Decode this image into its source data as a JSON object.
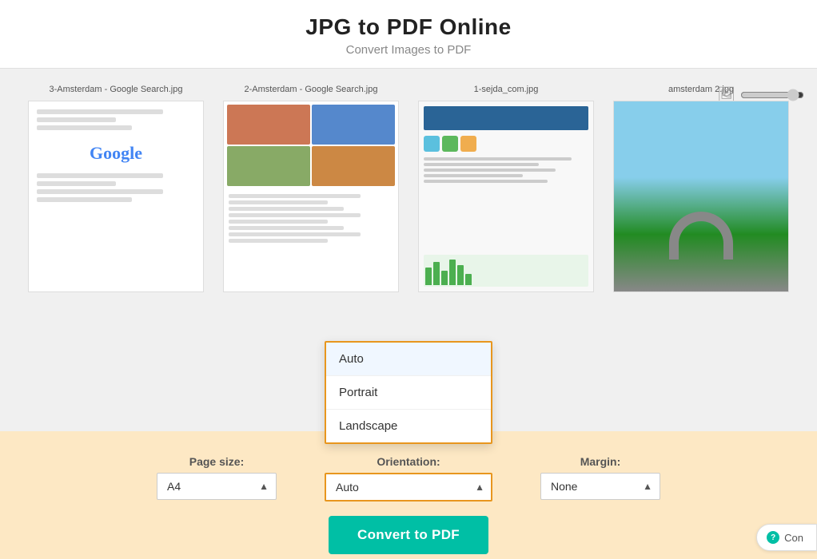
{
  "header": {
    "title": "JPG to PDF Online",
    "subtitle": "Convert Images to PDF"
  },
  "zoom": {
    "value": 90
  },
  "images": [
    {
      "id": "img1",
      "label": "3-Amsterdam - Google Search.jpg",
      "type": "google1"
    },
    {
      "id": "img2",
      "label": "2-Amsterdam - Google Search.jpg",
      "type": "amsterdam"
    },
    {
      "id": "img3",
      "label": "1-sejda_com.jpg",
      "type": "sejda"
    },
    {
      "id": "img4",
      "label": "amsterdam 2.jpg",
      "type": "photo"
    }
  ],
  "controls": {
    "page_size_label": "Page size:",
    "page_size_value": "A4",
    "margin_label": "Margin:",
    "margin_value": "None",
    "orientation_label": "Orientation:",
    "orientation_value": "Auto"
  },
  "dropdown": {
    "options": [
      {
        "label": "Auto",
        "selected": true
      },
      {
        "label": "Portrait",
        "selected": false
      },
      {
        "label": "Landscape",
        "selected": false
      }
    ],
    "current": "Auto"
  },
  "convert_button": {
    "label": "Convert to PDF"
  },
  "con_button": {
    "label": "Con"
  }
}
